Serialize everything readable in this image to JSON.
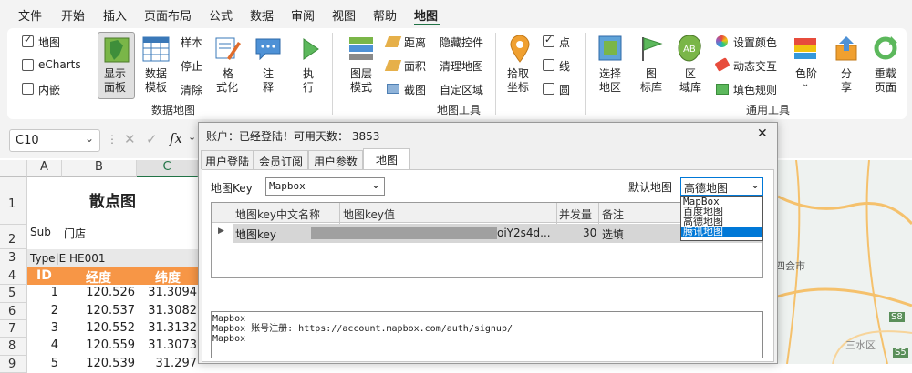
{
  "menu": [
    "文件",
    "开始",
    "插入",
    "页面布局",
    "公式",
    "数据",
    "审阅",
    "视图",
    "帮助",
    "地图"
  ],
  "ribbon": {
    "checks": [
      {
        "label": "地图",
        "checked": true
      },
      {
        "label": "eCharts",
        "checked": false
      },
      {
        "label": "内嵌",
        "checked": false
      }
    ],
    "show_panel": [
      "显示",
      "面板"
    ],
    "data_template": [
      "数据",
      "模板"
    ],
    "sample": "样本",
    "stop": "停止",
    "clear": "清除",
    "format": [
      "格",
      "式化"
    ],
    "note": [
      "注",
      "释"
    ],
    "execute": [
      "执",
      "行"
    ],
    "group_data_map": "数据地图",
    "layer_mode": [
      "图层",
      "模式"
    ],
    "distance": "距离",
    "area": "面积",
    "screenshot": "截图",
    "hide_control": "隐藏控件",
    "clear_map": "清理地图",
    "custom_region": "自定区域",
    "group_map_tools": "地图工具",
    "pick_coord": [
      "拾取",
      "坐标"
    ],
    "point_checks": [
      {
        "label": "点",
        "checked": true
      },
      {
        "label": "线",
        "checked": false
      },
      {
        "label": "圆",
        "checked": false
      }
    ],
    "select_region": [
      "选择",
      "地区"
    ],
    "icon_lib": [
      "图",
      "标库"
    ],
    "region_lib": [
      "区",
      "域库"
    ],
    "set_color": "设置颜色",
    "dynamic_interact": "动态交互",
    "fill_rule": "填色规则",
    "color_scale": "色阶",
    "share": [
      "分",
      "享"
    ],
    "reload": [
      "重载",
      "页面"
    ],
    "group_general_tools": "通用工具"
  },
  "formula_bar": {
    "name_box": "C10",
    "fx": "fx"
  },
  "sheet": {
    "columns": [
      "A",
      "B",
      "C"
    ],
    "title": "散点图",
    "row2": [
      "Sub",
      "门店"
    ],
    "row3": "Type|E HE001",
    "headers": [
      "ID",
      "经度",
      "纬度"
    ],
    "rows": [
      {
        "id": "1",
        "lng": "120.526",
        "lat": "31.3094"
      },
      {
        "id": "2",
        "lng": "120.537",
        "lat": "31.3082"
      },
      {
        "id": "3",
        "lng": "120.552",
        "lat": "31.3132"
      },
      {
        "id": "4",
        "lng": "120.559",
        "lat": "31.3073"
      },
      {
        "id": "5",
        "lng": "120.539",
        "lat": "31.297"
      }
    ],
    "row_numbers": [
      "1",
      "2",
      "3",
      "4",
      "5",
      "6",
      "7",
      "8",
      "9"
    ]
  },
  "dialog": {
    "title": "账户：已经登陆！可用天数：  3853",
    "close": "✕",
    "tabs": [
      "用户登陆",
      "会员订阅",
      "用户参数",
      "地图"
    ],
    "map_key_label": "地图Key",
    "map_key_value": "Mapbox",
    "default_map_label": "默认地图",
    "default_map_value": "高德地图",
    "dropdown_options": [
      "MapBox",
      "百度地图",
      "高德地图",
      "腾讯地图"
    ],
    "table_headers": [
      "地图key中文名称",
      "地图key值",
      "并发量",
      "备注"
    ],
    "table_row": {
      "name": "地图key",
      "value": "oiY2s4d...",
      "concurrency": "30",
      "note": "选填"
    },
    "info_lines": [
      "Mapbox",
      "Mapbox 账号注册: https://account.mapbox.com/auth/signup/",
      "Mapbox"
    ]
  },
  "map_labels": [
    "四会市",
    "S8",
    "三水区",
    "S5"
  ],
  "colors": {
    "accent": "#217346",
    "header_orange": "#f79646",
    "selection": "#0078d7"
  }
}
